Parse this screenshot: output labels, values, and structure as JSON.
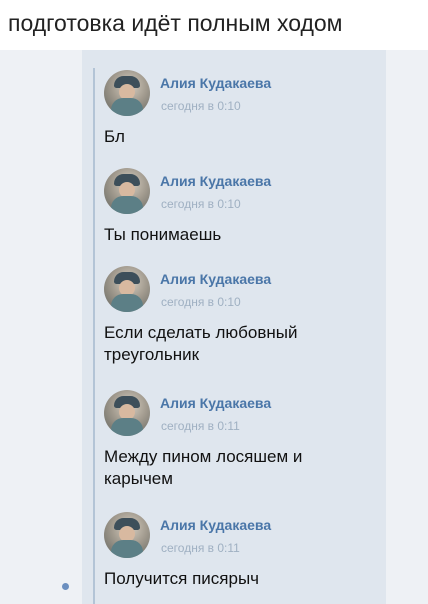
{
  "caption": "подготовка идёт полным ходом",
  "messages": [
    {
      "author": "Алия Кудакаева",
      "time": "сегодня в 0:10",
      "text": "Бл"
    },
    {
      "author": "Алия Кудакаева",
      "time": "сегодня в 0:10",
      "text": "Ты понимаешь"
    },
    {
      "author": "Алия Кудакаева",
      "time": "сегодня в 0:10",
      "text": "Если сделать любовный треугольник"
    },
    {
      "author": "Алия Кудакаева",
      "time": "сегодня в 0:11",
      "text": "Между пином лосяшем и карычем"
    },
    {
      "author": "Алия Кудакаева",
      "time": "сегодня в 0:11",
      "text": "Получится писярыч"
    }
  ],
  "colors": {
    "author_link": "#4a76a8",
    "timestamp": "#9fb0c2",
    "quote_bar": "#b3c4d6",
    "unread_dot": "#6b8fbf"
  },
  "icons": [
    "avatar",
    "unread-dot-icon"
  ]
}
